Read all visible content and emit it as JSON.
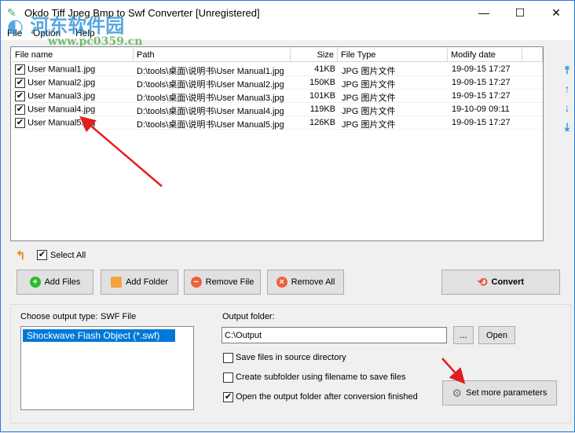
{
  "window": {
    "title": "Okdo Tiff Jpeg Bmp to Swf Converter [Unregistered]",
    "minimize": "—",
    "maximize": "☐",
    "close": "✕"
  },
  "watermark": {
    "line1": "河东软件园",
    "line2": "www.pc0359.cn"
  },
  "menu": [
    "File",
    "Option",
    "Help"
  ],
  "columns": [
    "File name",
    "Path",
    "Size",
    "File Type",
    "Modify date"
  ],
  "files": [
    {
      "name": "User Manual1.jpg",
      "path": "D:\\tools\\桌面\\说明书\\User Manual1.jpg",
      "size": "41KB",
      "type": "JPG 图片文件",
      "date": "19-09-15 17:27",
      "checked": true
    },
    {
      "name": "User Manual2.jpg",
      "path": "D:\\tools\\桌面\\说明书\\User Manual2.jpg",
      "size": "150KB",
      "type": "JPG 图片文件",
      "date": "19-09-15 17:27",
      "checked": true
    },
    {
      "name": "User Manual3.jpg",
      "path": "D:\\tools\\桌面\\说明书\\User Manual3.jpg",
      "size": "101KB",
      "type": "JPG 图片文件",
      "date": "19-09-15 17:27",
      "checked": true
    },
    {
      "name": "User Manual4.jpg",
      "path": "D:\\tools\\桌面\\说明书\\User Manual4.jpg",
      "size": "119KB",
      "type": "JPG 图片文件",
      "date": "19-10-09 09:11",
      "checked": true
    },
    {
      "name": "User Manual5.jpg",
      "path": "D:\\tools\\桌面\\说明书\\User Manual5.jpg",
      "size": "126KB",
      "type": "JPG 图片文件",
      "date": "19-09-15 17:27",
      "checked": true
    }
  ],
  "select_all": {
    "label": "Select All",
    "checked": true
  },
  "buttons": {
    "add_files": "Add Files",
    "add_folder": "Add Folder",
    "remove_file": "Remove File",
    "remove_all": "Remove All",
    "convert": "Convert",
    "browse": "...",
    "open": "Open",
    "set_params": "Set more parameters"
  },
  "output": {
    "type_label": "Choose output type:",
    "type_value": "SWF File",
    "type_options": [
      "Shockwave Flash Object (*.swf)"
    ],
    "folder_label": "Output folder:",
    "folder_value": "C:\\Output"
  },
  "options": [
    {
      "label": "Save files in source directory",
      "checked": false
    },
    {
      "label": "Create subfolder using filename to save files",
      "checked": false
    },
    {
      "label": "Open the output folder after conversion finished",
      "checked": true
    }
  ]
}
